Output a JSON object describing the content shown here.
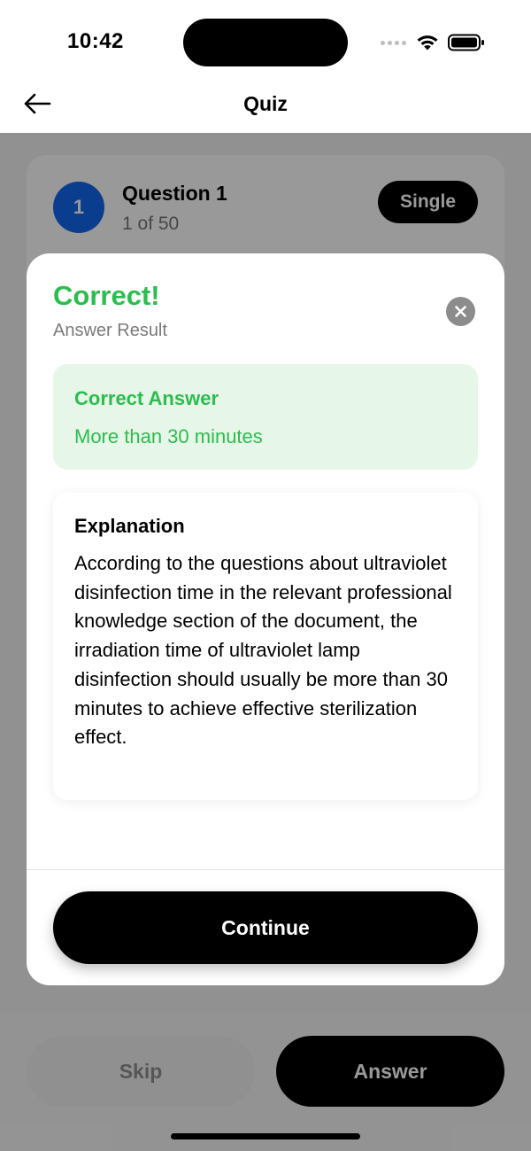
{
  "status_bar": {
    "time": "10:42"
  },
  "nav": {
    "title": "Quiz",
    "back_icon": "arrow-left-icon"
  },
  "question_card": {
    "number": "1",
    "title": "Question 1",
    "progress": "1 of 50",
    "type_badge": "Single"
  },
  "bottom_bar": {
    "skip_label": "Skip",
    "answer_label": "Answer"
  },
  "result_modal": {
    "title": "Correct!",
    "subtitle": "Answer Result",
    "close_icon": "close-icon",
    "correct_answer": {
      "label": "Correct Answer",
      "value": "More than 30 minutes"
    },
    "explanation": {
      "label": "Explanation",
      "text": "According to the questions about ultraviolet disinfection time in the relevant professional knowledge section of the document, the irradiation time of ultraviolet lamp disinfection should usually be more than 30 minutes to achieve effective sterilization effect."
    },
    "continue_label": "Continue"
  },
  "colors": {
    "success": "#2dbd4e",
    "success_bg": "#e6f6e9",
    "primary": "#1366ee",
    "button": "#000000"
  }
}
